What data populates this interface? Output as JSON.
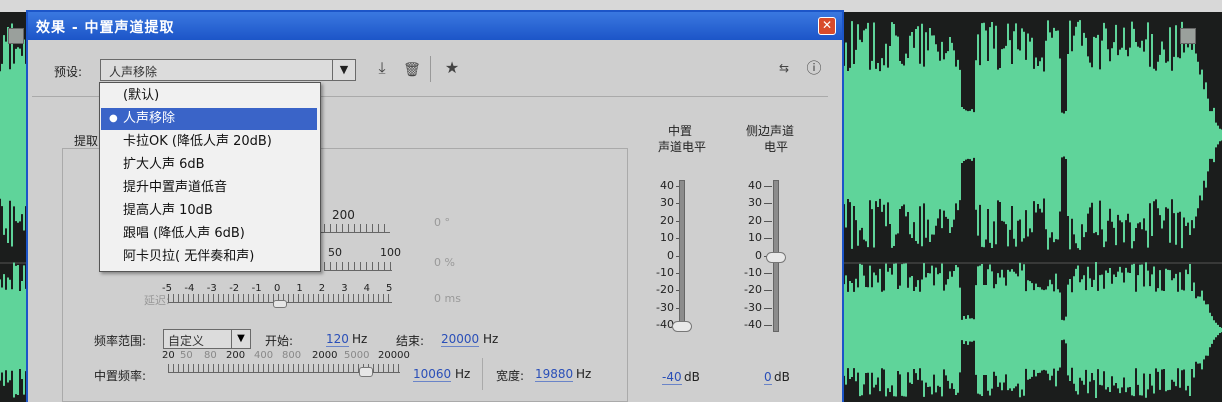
{
  "dialog": {
    "title": "效果 - 中置声道提取",
    "close_glyph": "✕"
  },
  "preset": {
    "label": "预设:",
    "value": "人声移除",
    "items": [
      {
        "label": "(默认)"
      },
      {
        "label": "人声移除"
      },
      {
        "label": "卡拉OK (降低人声 20dB)"
      },
      {
        "label": "扩大人声 6dB"
      },
      {
        "label": "提升中置声道低音"
      },
      {
        "label": "提高人声 10dB"
      },
      {
        "label": "跟唱 (降低人声 6dB)"
      },
      {
        "label": "阿卡贝拉( 无伴奏和声)"
      }
    ],
    "selected_index": 1
  },
  "toolbar": {
    "save_icon": "download-icon",
    "delete_icon": "trash-icon",
    "favorite_icon": "star-icon",
    "routing_icon": "routing-icon",
    "info_icon": "info-icon"
  },
  "tab": {
    "label": "提取"
  },
  "sliders": {
    "phase_scale_label": "200",
    "phase_value": "0 °",
    "pan_scale": [
      "50",
      "100"
    ],
    "pan_value": "0 %",
    "delay_ticks": [
      "-5",
      "-4",
      "-3",
      "-2",
      "-1",
      "0",
      "1",
      "2",
      "3",
      "4",
      "5"
    ],
    "delay_label": "延迟:",
    "delay_value": "0 ms"
  },
  "frequency": {
    "range_label": "频率范围:",
    "range_value": "自定义",
    "start_label": "开始:",
    "start_value": "120",
    "start_unit": "Hz",
    "end_label": "结束:",
    "end_value": "20000",
    "end_unit": "Hz",
    "center_label": "中置频率:",
    "center_ticks": [
      "20",
      "50",
      "80",
      "200",
      "400",
      "800",
      "2000",
      "5000",
      "20000"
    ],
    "center_value": "10060",
    "center_unit": "Hz",
    "width_label": "宽度:",
    "width_value": "19880",
    "width_unit": "Hz"
  },
  "levels": {
    "center_title_1": "中置",
    "center_title_2": "声道电平",
    "side_title_1": "侧边声道",
    "side_title_2": "电平",
    "ticks": [
      "40",
      "30",
      "20",
      "10",
      "0",
      "-10",
      "-20",
      "-30",
      "-40"
    ],
    "center_value": "-40",
    "center_unit": "dB",
    "side_value": "0",
    "side_unit": "dB"
  },
  "colors": {
    "waveform": "#5fd49a",
    "titlebar": "#1c55c8",
    "selection": "#3a64c8"
  }
}
